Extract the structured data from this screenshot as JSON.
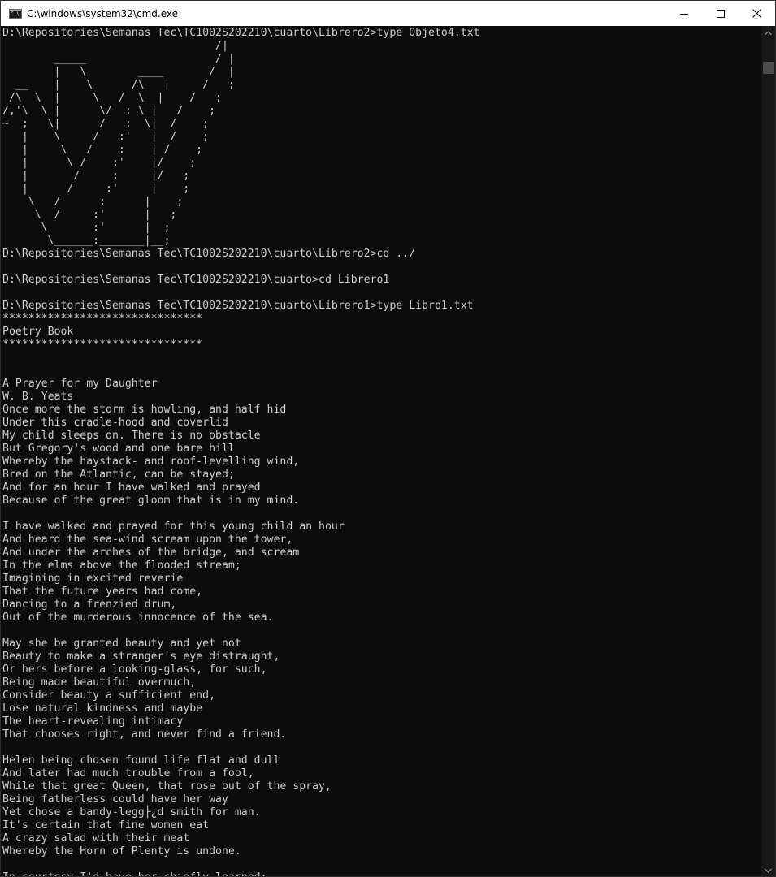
{
  "window": {
    "title": "C:\\windows\\system32\\cmd.exe",
    "icon": "console-app-icon"
  },
  "title_controls": {
    "minimize": "minimize-icon",
    "maximize": "maximize-icon",
    "close": "close-icon"
  },
  "colors": {
    "console_background": "#0c0c0c",
    "console_text": "#cccccc",
    "titlebar_background": "#ffffff"
  },
  "console": {
    "lines": [
      "D:\\Repositories\\Semanas Tec\\TC1002S202210\\cuarto\\Librero2>type Objeto4.txt",
      "                                 /|",
      "        _____                    / |",
      "        |   \\        ____       /  |",
      "  __    |    \\      /\\   |     /   ;",
      " /\\  \\  |     \\   /  \\  |    /   ;",
      "/,'\\  \\ |      \\/  : \\ |   /    ;",
      "~  ;   \\|      /   :  \\|  /    ;",
      "   |    \\     /   :'   |  /    ;",
      "   |     \\   /    :    | /    ;",
      "   |      \\ /    :'    |/    ;",
      "   |       /     :     |/   ;",
      "   |      /     :'     |    ;",
      "    \\   /      :      |    ;",
      "     \\  /     :'      |   ;",
      "      \\       :'      |  ;",
      "       \\______:_______|__;",
      "D:\\Repositories\\Semanas Tec\\TC1002S202210\\cuarto\\Librero2>cd ../",
      "",
      "D:\\Repositories\\Semanas Tec\\TC1002S202210\\cuarto>cd Librero1",
      "",
      "D:\\Repositories\\Semanas Tec\\TC1002S202210\\cuarto\\Librero1>type Libro1.txt",
      "*******************************",
      "Poetry Book",
      "*******************************",
      "",
      "",
      "A Prayer for my Daughter",
      "W. B. Yeats",
      "Once more the storm is howling, and half hid",
      "Under this cradle-hood and coverlid",
      "My child sleeps on. There is no obstacle",
      "But Gregory's wood and one bare hill",
      "Whereby the haystack- and roof-levelling wind,",
      "Bred on the Atlantic, can be stayed;",
      "And for an hour I have walked and prayed",
      "Because of the great gloom that is in my mind.",
      "",
      "I have walked and prayed for this young child an hour",
      "And heard the sea-wind scream upon the tower,",
      "And under the arches of the bridge, and scream",
      "In the elms above the flooded stream;",
      "Imagining in excited reverie",
      "That the future years had come,",
      "Dancing to a frenzied drum,",
      "Out of the murderous innocence of the sea.",
      "",
      "May she be granted beauty and yet not",
      "Beauty to make a stranger's eye distraught,",
      "Or hers before a looking-glass, for such,",
      "Being made beautiful overmuch,",
      "Consider beauty a sufficient end,",
      "Lose natural kindness and maybe",
      "The heart-revealing intimacy",
      "That chooses right, and never find a friend.",
      "",
      "Helen being chosen found life flat and dull",
      "And later had much trouble from a fool,",
      "While that great Queen, that rose out of the spray,",
      "Being fatherless could have her way",
      "Yet chose a bandy-legg├¿d smith for man.",
      "It's certain that fine women eat",
      "A crazy salad with their meat",
      "Whereby the Horn of Plenty is undone.",
      "",
      "In courtesy I'd have her chiefly learned;"
    ]
  }
}
